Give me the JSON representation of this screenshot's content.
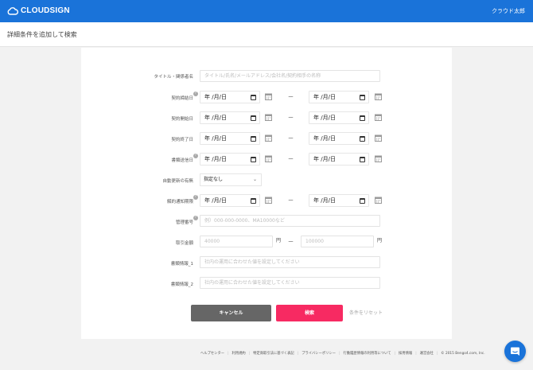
{
  "header": {
    "logo_text": "CLOUDSIGN",
    "user_name": "クラウド太郎",
    "brand_color": "#1a73d9"
  },
  "page": {
    "title": "詳細条件を追加して検索"
  },
  "form": {
    "title_field": {
      "label": "タイトル・関係者名",
      "placeholder": "タイトル/氏名/メールアドレス/会社名/契約相手の名称"
    },
    "contract_date": {
      "label": "契約締結日",
      "from": "年 /月/日",
      "to": "年 /月/日",
      "separator": "ー",
      "help": "?"
    },
    "start_date": {
      "label": "契約開始日",
      "from": "年 /月/日",
      "to": "年 /月/日",
      "separator": "ー"
    },
    "end_date": {
      "label": "契約終了日",
      "from": "年 /月/日",
      "to": "年 /月/日",
      "separator": "ー"
    },
    "sent_date": {
      "label": "書類送信日",
      "from": "年 /月/日",
      "to": "年 /月/日",
      "separator": "ー",
      "help": "?"
    },
    "auto_renewal": {
      "label": "自動更新の有無",
      "value": "指定なし"
    },
    "cancel_notice": {
      "label": "解約通知期限",
      "from": "年 /月/日",
      "to": "年 /月/日",
      "separator": "ー",
      "help": "?"
    },
    "management_no": {
      "label": "管理番号",
      "placeholder": "例）000-000-0000、MA10000など",
      "help": "?"
    },
    "amount": {
      "label": "取引金額",
      "min_placeholder": "40000",
      "max_placeholder": "100000",
      "unit": "円",
      "separator": "ー"
    },
    "doc_info_1": {
      "label": "書類情報_1",
      "placeholder": "社内の運用に合わせた値を設定してください"
    },
    "doc_info_2": {
      "label": "書類情報_2",
      "placeholder": "社内の運用に合わせた値を設定してください"
    }
  },
  "actions": {
    "cancel_label": "キャンセル",
    "search_label": "検索",
    "reset_label": "条件をリセット",
    "search_color": "#f72a62"
  },
  "footer": {
    "links": [
      "ヘルプセンター",
      "利用規約",
      "特定商取引法に基づく表記",
      "プライバシーポリシー",
      "行動履歴情報の利用等について",
      "採用情報",
      "運営会社"
    ],
    "copyright": "© 2015 Bengo4.com, Inc."
  }
}
